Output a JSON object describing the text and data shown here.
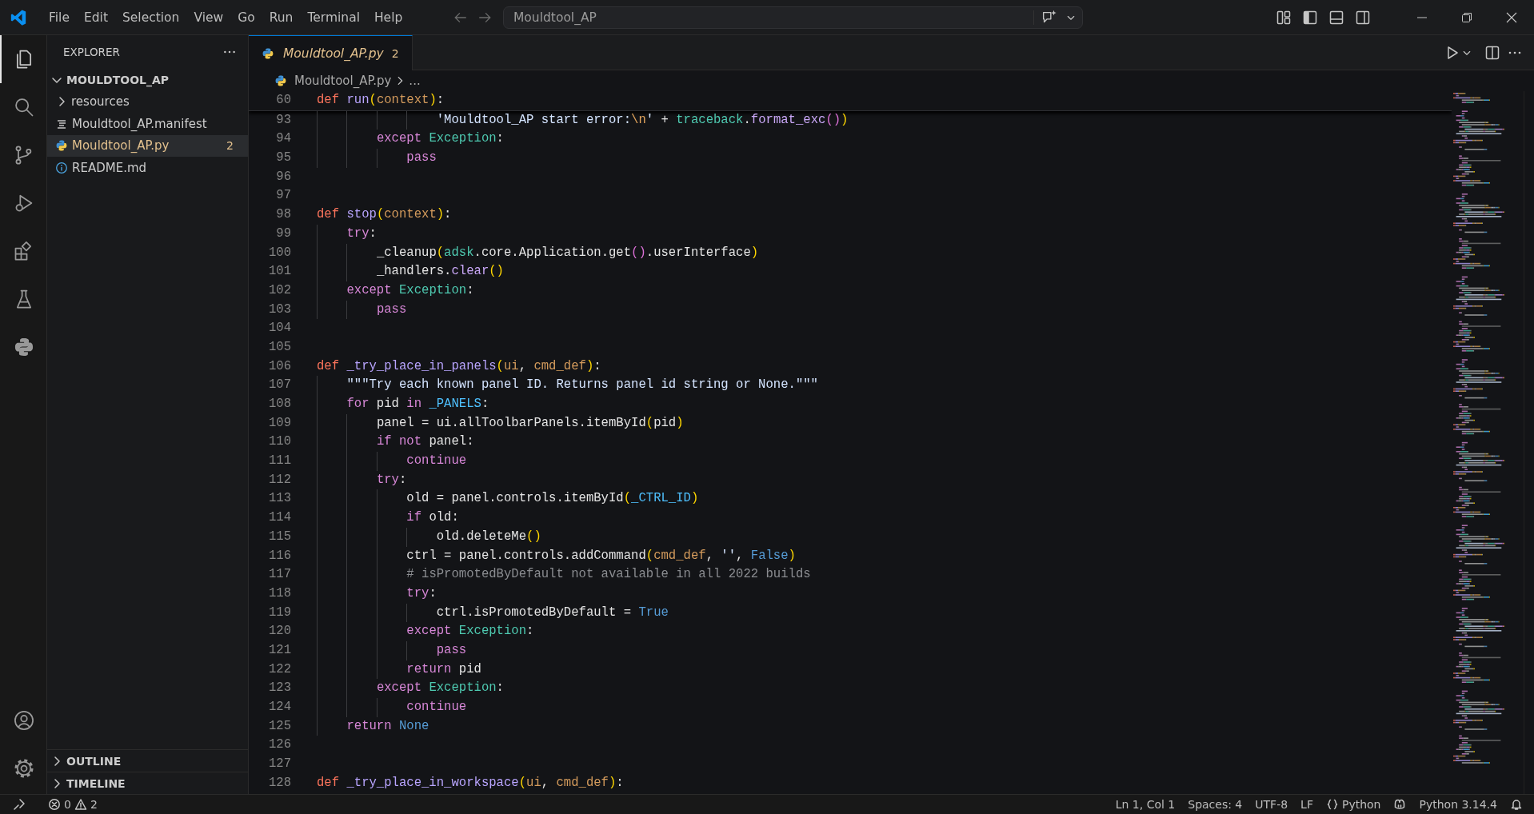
{
  "title_bar": {
    "menu": [
      "File",
      "Edit",
      "Selection",
      "View",
      "Go",
      "Run",
      "Terminal",
      "Help"
    ],
    "search": {
      "value": "Mouldtool_AP"
    },
    "layout_toggles": [
      {
        "kind": "primary-sidebar",
        "on": true
      },
      {
        "kind": "panel",
        "on": false
      },
      {
        "kind": "secondary-sidebar",
        "on": false
      }
    ]
  },
  "activity_bar": {
    "items": [
      {
        "kind": "files",
        "selected": true
      },
      {
        "kind": "search",
        "selected": false
      },
      {
        "kind": "source-control",
        "selected": false
      },
      {
        "kind": "run-debug",
        "selected": false
      },
      {
        "kind": "extensions",
        "selected": false
      },
      {
        "kind": "testing",
        "selected": false
      },
      {
        "kind": "python",
        "selected": false
      },
      {
        "kind": "account",
        "selected": false
      },
      {
        "kind": "settings",
        "selected": false
      }
    ]
  },
  "sidebar": {
    "title": "EXPLORER",
    "folder": {
      "name": "MOULDTOOL_AP",
      "expanded": true,
      "children": [
        {
          "name": "resources",
          "kind": "folder",
          "expanded": false,
          "selected": false
        },
        {
          "name": "Mouldtool_AP.manifest",
          "kind": "manifest",
          "selected": false
        },
        {
          "name": "Mouldtool_AP.py",
          "kind": "python",
          "selected": true,
          "badge": "2"
        },
        {
          "name": "README.md",
          "kind": "info",
          "selected": false
        }
      ]
    },
    "sections": [
      {
        "title": "OUTLINE",
        "expanded": false
      },
      {
        "title": "TIMELINE",
        "expanded": false
      }
    ]
  },
  "editor": {
    "tabs": [
      {
        "label": "Mouldtool_AP.py",
        "badge": "2",
        "selected": true,
        "preview": true
      }
    ],
    "breadcrumb": [
      "Mouldtool_AP.py",
      "..."
    ],
    "sticky_line": {
      "number": "60",
      "tokens": [
        {
          "kind": "kw",
          "text": "def"
        },
        {
          "kind": "fn",
          "text": " run"
        },
        {
          "kind": "p1",
          "text": "("
        },
        {
          "kind": "param",
          "text": "context"
        },
        {
          "kind": "p1",
          "text": ")"
        },
        {
          "kind": "var",
          "text": ":"
        }
      ]
    },
    "lines": [
      {
        "number": "93",
        "tokens": [
          {
            "kind": "str",
            "text": "                'Mouldtool_AP start error:"
          },
          {
            "kind": "esc",
            "text": "\\n"
          },
          {
            "kind": "str",
            "text": "'"
          },
          {
            "kind": "var",
            "text": " + "
          },
          {
            "kind": "cls",
            "text": "traceback"
          },
          {
            "kind": "var",
            "text": "."
          },
          {
            "kind": "meth",
            "text": "format_exc"
          },
          {
            "kind": "p2",
            "text": "()"
          },
          {
            "kind": "p1",
            "text": ")"
          }
        ]
      },
      {
        "number": "94",
        "tokens": [
          {
            "kind": "ctrl",
            "text": "        except"
          },
          {
            "kind": "cls",
            "text": " Exception"
          },
          {
            "kind": "var",
            "text": ":"
          }
        ]
      },
      {
        "number": "95",
        "tokens": [
          {
            "kind": "ctrl",
            "text": "            pass"
          }
        ]
      },
      {
        "number": "96"
      },
      {
        "number": "97"
      },
      {
        "number": "98",
        "tokens": [
          {
            "kind": "kw",
            "text": "def"
          },
          {
            "kind": "fn",
            "text": " stop"
          },
          {
            "kind": "p1",
            "text": "("
          },
          {
            "kind": "param",
            "text": "context"
          },
          {
            "kind": "p1",
            "text": ")"
          },
          {
            "kind": "var",
            "text": ":"
          }
        ]
      },
      {
        "number": "99",
        "tokens": [
          {
            "kind": "ctrl",
            "text": "    try"
          },
          {
            "kind": "var",
            "text": ":"
          }
        ]
      },
      {
        "number": "100",
        "tokens": [
          {
            "kind": "var",
            "text": "        _cleanup"
          },
          {
            "kind": "p1",
            "text": "("
          },
          {
            "kind": "cls",
            "text": "adsk"
          },
          {
            "kind": "var",
            "text": ".core.Application.get"
          },
          {
            "kind": "p2",
            "text": "()"
          },
          {
            "kind": "var",
            "text": ".userInterface"
          },
          {
            "kind": "p1",
            "text": ")"
          }
        ]
      },
      {
        "number": "101",
        "tokens": [
          {
            "kind": "var",
            "text": "        _handlers."
          },
          {
            "kind": "meth",
            "text": "clear"
          },
          {
            "kind": "p1",
            "text": "()"
          }
        ]
      },
      {
        "number": "102",
        "tokens": [
          {
            "kind": "ctrl",
            "text": "    except"
          },
          {
            "kind": "cls",
            "text": " Exception"
          },
          {
            "kind": "var",
            "text": ":"
          }
        ]
      },
      {
        "number": "103",
        "tokens": [
          {
            "kind": "ctrl",
            "text": "        pass"
          }
        ]
      },
      {
        "number": "104"
      },
      {
        "number": "105"
      },
      {
        "number": "106",
        "tokens": [
          {
            "kind": "kw",
            "text": "def"
          },
          {
            "kind": "fn",
            "text": " _try_place_in_panels"
          },
          {
            "kind": "p1",
            "text": "("
          },
          {
            "kind": "param",
            "text": "ui"
          },
          {
            "kind": "var",
            "text": ", "
          },
          {
            "kind": "param",
            "text": "cmd_def"
          },
          {
            "kind": "p1",
            "text": ")"
          },
          {
            "kind": "var",
            "text": ":"
          }
        ]
      },
      {
        "number": "107",
        "tokens": [
          {
            "kind": "str",
            "text": "    \"\"\"Try each known panel ID. Returns panel id string or None.\"\"\""
          }
        ]
      },
      {
        "number": "108",
        "tokens": [
          {
            "kind": "ctrl",
            "text": "    for"
          },
          {
            "kind": "var",
            "text": " pid "
          },
          {
            "kind": "ctrl",
            "text": "in"
          },
          {
            "kind": "glob",
            "text": " _PANELS"
          },
          {
            "kind": "var",
            "text": ":"
          }
        ]
      },
      {
        "number": "109",
        "tokens": [
          {
            "kind": "var",
            "text": "        panel = ui.allToolbarPanels.itemById"
          },
          {
            "kind": "p1",
            "text": "("
          },
          {
            "kind": "var",
            "text": "pid"
          },
          {
            "kind": "p1",
            "text": ")"
          }
        ]
      },
      {
        "number": "110",
        "tokens": [
          {
            "kind": "ctrl",
            "text": "        if"
          },
          {
            "kind": "ctrl",
            "text": " not"
          },
          {
            "kind": "var",
            "text": " panel:"
          }
        ]
      },
      {
        "number": "111",
        "tokens": [
          {
            "kind": "ctrl",
            "text": "            continue"
          }
        ]
      },
      {
        "number": "112",
        "tokens": [
          {
            "kind": "ctrl",
            "text": "        try"
          },
          {
            "kind": "var",
            "text": ":"
          }
        ]
      },
      {
        "number": "113",
        "tokens": [
          {
            "kind": "var",
            "text": "            old = panel.controls.itemById"
          },
          {
            "kind": "p1",
            "text": "("
          },
          {
            "kind": "glob",
            "text": "_CTRL_ID"
          },
          {
            "kind": "p1",
            "text": ")"
          }
        ]
      },
      {
        "number": "114",
        "tokens": [
          {
            "kind": "ctrl",
            "text": "            if"
          },
          {
            "kind": "var",
            "text": " old:"
          }
        ]
      },
      {
        "number": "115",
        "tokens": [
          {
            "kind": "var",
            "text": "                old.deleteMe"
          },
          {
            "kind": "p1",
            "text": "()"
          }
        ]
      },
      {
        "number": "116",
        "tokens": [
          {
            "kind": "var",
            "text": "            ctrl = panel.controls.addCommand"
          },
          {
            "kind": "p1",
            "text": "("
          },
          {
            "kind": "param",
            "text": "cmd_def"
          },
          {
            "kind": "var",
            "text": ", "
          },
          {
            "kind": "str",
            "text": "''"
          },
          {
            "kind": "var",
            "text": ", "
          },
          {
            "kind": "const",
            "text": "False"
          },
          {
            "kind": "p1",
            "text": ")"
          }
        ]
      },
      {
        "number": "117",
        "tokens": [
          {
            "kind": "cmt",
            "text": "            # isPromotedByDefault not available in all 2022 builds"
          }
        ]
      },
      {
        "number": "118",
        "tokens": [
          {
            "kind": "ctrl",
            "text": "            try"
          },
          {
            "kind": "var",
            "text": ":"
          }
        ]
      },
      {
        "number": "119",
        "tokens": [
          {
            "kind": "var",
            "text": "                ctrl.isPromotedByDefault = "
          },
          {
            "kind": "const",
            "text": "True"
          }
        ]
      },
      {
        "number": "120",
        "tokens": [
          {
            "kind": "ctrl",
            "text": "            except"
          },
          {
            "kind": "cls",
            "text": " Exception"
          },
          {
            "kind": "var",
            "text": ":"
          }
        ]
      },
      {
        "number": "121",
        "tokens": [
          {
            "kind": "ctrl",
            "text": "                pass"
          }
        ]
      },
      {
        "number": "122",
        "tokens": [
          {
            "kind": "ctrl",
            "text": "            return"
          },
          {
            "kind": "var",
            "text": " pid"
          }
        ]
      },
      {
        "number": "123",
        "tokens": [
          {
            "kind": "ctrl",
            "text": "        except"
          },
          {
            "kind": "cls",
            "text": " Exception"
          },
          {
            "kind": "var",
            "text": ":"
          }
        ]
      },
      {
        "number": "124",
        "tokens": [
          {
            "kind": "ctrl",
            "text": "            continue"
          }
        ]
      },
      {
        "number": "125",
        "tokens": [
          {
            "kind": "ctrl",
            "text": "    return"
          },
          {
            "kind": "const",
            "text": " None"
          }
        ]
      },
      {
        "number": "126"
      },
      {
        "number": "127"
      },
      {
        "number": "128",
        "tokens": [
          {
            "kind": "kw",
            "text": "def"
          },
          {
            "kind": "fn",
            "text": " _try_place_in_workspace"
          },
          {
            "kind": "p1",
            "text": "("
          },
          {
            "kind": "param",
            "text": "ui"
          },
          {
            "kind": "var",
            "text": ", "
          },
          {
            "kind": "param",
            "text": "cmd_def"
          },
          {
            "kind": "p1",
            "text": ")"
          },
          {
            "kind": "var",
            "text": ":"
          }
        ]
      }
    ]
  },
  "status_bar": {
    "problems": {
      "errors": "0",
      "warnings": "2"
    },
    "items": [
      {
        "kind": "text",
        "text": "Ln 1, Col 1"
      },
      {
        "kind": "text",
        "text": "Spaces: 4"
      },
      {
        "kind": "text",
        "text": "UTF-8"
      },
      {
        "kind": "text",
        "text": "LF"
      },
      {
        "kind": "language",
        "text": "Python"
      },
      {
        "kind": "copilot"
      },
      {
        "kind": "text",
        "text": "Python 3.14.4"
      },
      {
        "kind": "bell"
      }
    ]
  }
}
